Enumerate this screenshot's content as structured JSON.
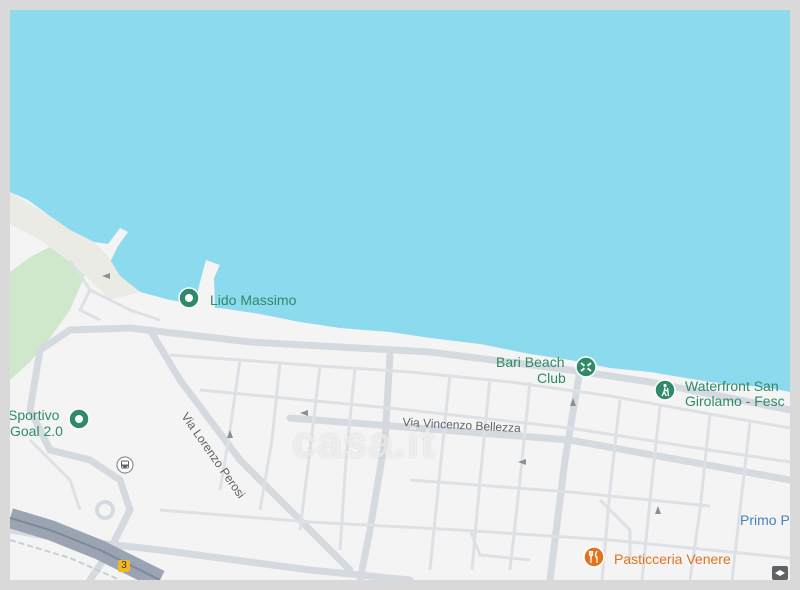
{
  "map": {
    "colors": {
      "sea": "#8cdaee",
      "land": "#f4f4f4",
      "park": "#cfe8cc",
      "road": "#d5dae1",
      "poi_green": "#2f8a67",
      "poi_orange": "#e2721e",
      "rail": "#9aa4b2"
    },
    "places": {
      "lido_massimo": "Lido Massimo",
      "bari_beach_club_line1": "Bari Beach",
      "bari_beach_club_line2": "Club",
      "waterfront_line1": "Waterfront San",
      "waterfront_line2": "Girolamo - Fesc",
      "sportivo_line1": "Sportivo",
      "sportivo_line2": "Goal 2.0",
      "pasticceria": "Pasticceria Venere",
      "primo": "Primo P"
    },
    "streets": {
      "via_vincenzo_bellezza": "Via Vincenzo Bellezza",
      "via_lorenzo_perosi": "Via Lorenzo Perosi"
    },
    "road_shield": "3",
    "watermark": "casa.it",
    "icons": [
      "place-pin-icon",
      "beach-club-icon",
      "hiking-icon",
      "bus-stop-icon",
      "restaurant-icon",
      "layers-icon"
    ]
  }
}
